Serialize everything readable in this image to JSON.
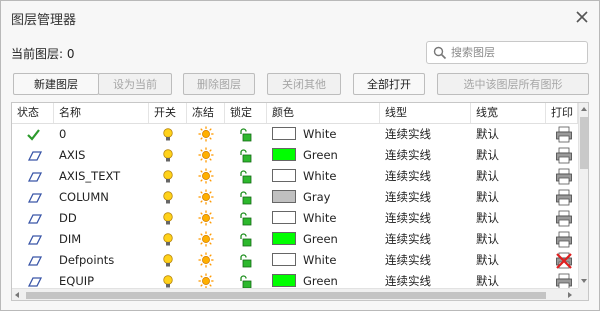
{
  "window": {
    "title": "图层管理器"
  },
  "current_layer": {
    "text": "当前图层: 0"
  },
  "search": {
    "placeholder": "搜索图层",
    "value": ""
  },
  "toolbar": {
    "buttons": [
      {
        "label": "新建图层",
        "enabled": true
      },
      {
        "label": "设为当前",
        "enabled": false
      },
      {
        "label": "删除图层",
        "enabled": false
      },
      {
        "label": "关闭其他",
        "enabled": false
      },
      {
        "label": "全部打开",
        "enabled": true
      },
      {
        "label": "选中该图层所有图形",
        "enabled": false
      }
    ]
  },
  "table": {
    "columns": [
      "状态",
      "名称",
      "开关",
      "冻结",
      "锁定",
      "颜色",
      "线型",
      "线宽",
      "打印"
    ],
    "rows": [
      {
        "status": "current-check-icon",
        "name": "0",
        "on": true,
        "frozen": false,
        "locked": false,
        "color_name": "White",
        "color_hex": "#ffffff",
        "linetype": "连续实线",
        "lineweight": "默认",
        "plot": true
      },
      {
        "status": "layer-icon",
        "name": "AXIS",
        "on": true,
        "frozen": false,
        "locked": false,
        "color_name": "Green",
        "color_hex": "#00ff00",
        "linetype": "连续实线",
        "lineweight": "默认",
        "plot": true
      },
      {
        "status": "layer-icon",
        "name": "AXIS_TEXT",
        "on": true,
        "frozen": false,
        "locked": false,
        "color_name": "White",
        "color_hex": "#ffffff",
        "linetype": "连续实线",
        "lineweight": "默认",
        "plot": true
      },
      {
        "status": "layer-icon",
        "name": "COLUMN",
        "on": true,
        "frozen": false,
        "locked": false,
        "color_name": "Gray",
        "color_hex": "#c0c0c0",
        "linetype": "连续实线",
        "lineweight": "默认",
        "plot": true
      },
      {
        "status": "layer-icon",
        "name": "DD",
        "on": true,
        "frozen": false,
        "locked": false,
        "color_name": "White",
        "color_hex": "#ffffff",
        "linetype": "连续实线",
        "lineweight": "默认",
        "plot": true
      },
      {
        "status": "layer-icon",
        "name": "DIM",
        "on": true,
        "frozen": false,
        "locked": false,
        "color_name": "Green",
        "color_hex": "#00ff00",
        "linetype": "连续实线",
        "lineweight": "默认",
        "plot": true
      },
      {
        "status": "layer-icon",
        "name": "Defpoints",
        "on": true,
        "frozen": false,
        "locked": false,
        "color_name": "White",
        "color_hex": "#ffffff",
        "linetype": "连续实线",
        "lineweight": "默认",
        "plot": false
      },
      {
        "status": "layer-icon",
        "name": "EQUIP",
        "on": true,
        "frozen": false,
        "locked": false,
        "color_name": "Green",
        "color_hex": "#00ff00",
        "linetype": "连续实线",
        "lineweight": "默认",
        "plot": true
      }
    ]
  }
}
